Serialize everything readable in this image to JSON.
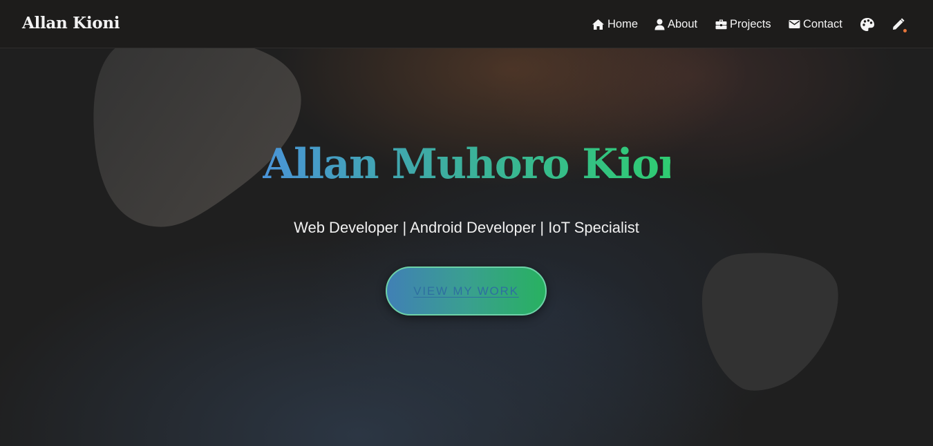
{
  "nav": {
    "brand": "Allan Kioni",
    "links": [
      {
        "label": "Home",
        "icon": "home-icon"
      },
      {
        "label": "About",
        "icon": "user-icon"
      },
      {
        "label": "Projects",
        "icon": "briefcase-icon"
      },
      {
        "label": "Contact",
        "icon": "envelope-icon"
      }
    ],
    "theme_icon": "palette-icon",
    "edit_icon": "pencil-icon"
  },
  "hero": {
    "title": "Allan Muhoro Kioni",
    "subtitle": "Web Developer | Android Developer | IoT Specialist",
    "cta_label": "VIEW MY WORK"
  },
  "colors": {
    "background": "#1e1e1e",
    "gradient_start": "#4a94d8",
    "gradient_end": "#2fcc72",
    "accent_dot": "#e8763a"
  }
}
